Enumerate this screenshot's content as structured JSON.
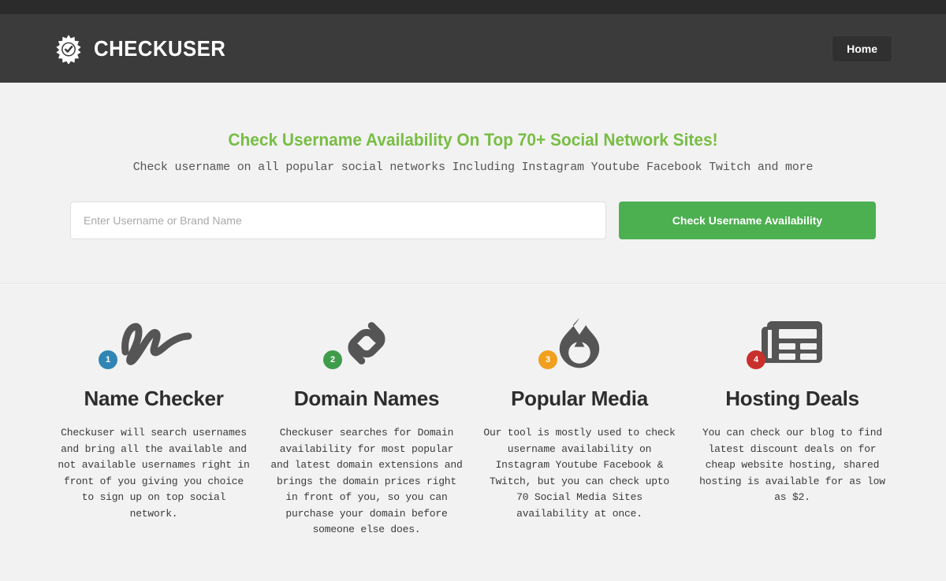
{
  "header": {
    "brand_name": "CHECKUSER",
    "brand_icon": "check-badge-sunburst-icon",
    "nav": {
      "home_label": "Home"
    },
    "colors": {
      "top_strip": "#2b2b2b",
      "bar": "#3b3b3b",
      "button": "#303030"
    }
  },
  "hero": {
    "title": "Check Username Availability On Top 70+ Social Network Sites!",
    "subtitle": "Check username on all popular social networks Including Instagram Youtube Facebook Twitch and more",
    "title_color": "#78bd44",
    "search": {
      "placeholder": "Enter Username or Brand Name",
      "value": "",
      "button_label": "Check Username Availability",
      "button_color": "#4caf50"
    }
  },
  "features": [
    {
      "number": "1",
      "badge_color": "#2f86b5",
      "icon": "signature-scribble-icon",
      "title": "Name Checker",
      "description": "Checkuser will search usernames and bring all the available and not available usernames right in front of you giving you choice to sign up on top social network."
    },
    {
      "number": "2",
      "badge_color": "#3f9c4b",
      "icon": "chain-link-icon",
      "title": "Domain Names",
      "description": "Checkuser searches for Domain availability for most popular and latest domain extensions and brings the domain prices right in front of you, so you can purchase your domain before someone else does."
    },
    {
      "number": "3",
      "badge_color": "#f0a01e",
      "icon": "flame-fire-icon",
      "title": "Popular Media",
      "description": "Our tool is mostly used to check username availability on Instagram Youtube Facebook & Twitch, but you can check upto 70 Social Media Sites availability at once."
    },
    {
      "number": "4",
      "badge_color": "#c9302c",
      "icon": "newspaper-icon",
      "title": "Hosting Deals",
      "description": "You can check our blog to find latest discount deals on for cheap website hosting, shared hosting is available for as low as $2."
    }
  ],
  "icon_color": "#555555"
}
